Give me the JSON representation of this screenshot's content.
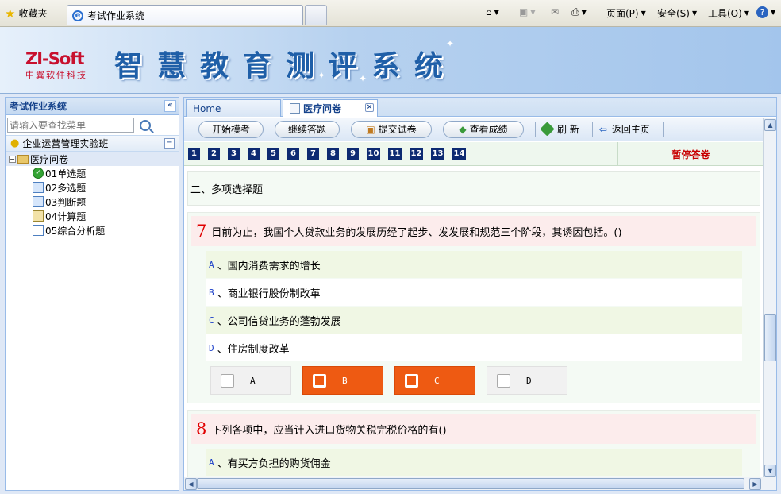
{
  "browser": {
    "favorites_label": "收藏夹",
    "tab_title": "考试作业系统",
    "commands": [
      "页面(P)",
      "安全(S)",
      "工具(O)"
    ]
  },
  "banner": {
    "logo": "ZI-Soft",
    "logo_sub": "中翼软件科技",
    "title": "智慧教育测评系统"
  },
  "sidebar": {
    "title": "考试作业系统",
    "search_placeholder": "请输入要查找菜单",
    "group": "企业运营管理实验班",
    "root": "医疗问卷",
    "items": [
      {
        "label": "01单选题",
        "icon": "check-circle-icon"
      },
      {
        "label": "02多选题",
        "icon": "hierarchy-icon"
      },
      {
        "label": "03判断题",
        "icon": "window-icon"
      },
      {
        "label": "04计算题",
        "icon": "calculator-icon"
      },
      {
        "label": "05综合分析题",
        "icon": "document-icon"
      }
    ]
  },
  "tabs": {
    "home": "Home",
    "active": "医疗问卷"
  },
  "toolbar": {
    "start": "开始模考",
    "continue": "继续答题",
    "submit": "提交试卷",
    "results": "查看成绩",
    "refresh": "刷 新",
    "back": "返回主页"
  },
  "question_nav": [
    "1",
    "2",
    "3",
    "4",
    "5",
    "6",
    "7",
    "8",
    "9",
    "10",
    "11",
    "12",
    "13",
    "14"
  ],
  "pause_label": "暂停答卷",
  "section_title": "二、多项选择题",
  "questions": [
    {
      "num": "7",
      "text": "目前为止，我国个人贷款业务的发展历经了起步、发发展和规范三个阶段，其诱因包括。()",
      "options": [
        {
          "letter": "A",
          "text": "、国内消费需求的增长"
        },
        {
          "letter": "B",
          "text": "、商业银行股份制改革"
        },
        {
          "letter": "C",
          "text": "、公司信贷业务的蓬勃发展"
        },
        {
          "letter": "D",
          "text": "、住房制度改革"
        }
      ],
      "answers": [
        {
          "letter": "A",
          "selected": false
        },
        {
          "letter": "B",
          "selected": true
        },
        {
          "letter": "C",
          "selected": true
        },
        {
          "letter": "D",
          "selected": false
        }
      ]
    },
    {
      "num": "8",
      "text": "下列各项中，应当计入进口货物关税完税价格的有()",
      "options": [
        {
          "letter": "A",
          "text": "、有买方负担的购货佣金"
        }
      ]
    }
  ],
  "colors": {
    "selected_answer": "#ee5a12",
    "nav_square": "#0d2a72",
    "pause": "#c80000"
  }
}
